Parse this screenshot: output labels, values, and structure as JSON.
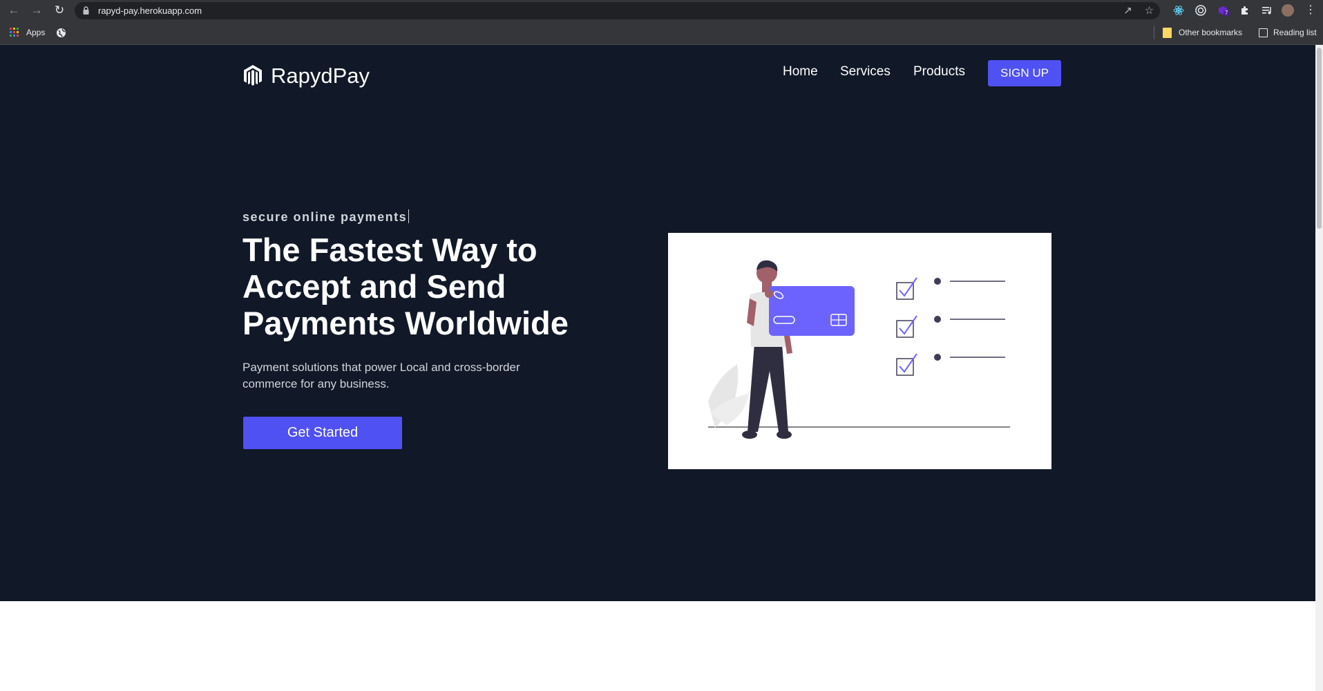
{
  "browser": {
    "url": "rapyd-pay.herokuapp.com",
    "bookmarks": {
      "apps_label": "Apps",
      "other_bookmarks_label": "Other bookmarks",
      "reading_list_label": "Reading list"
    },
    "extension_badge": "7",
    "icons": [
      "back-icon",
      "forward-icon",
      "reload-icon",
      "lock-icon",
      "share-icon",
      "star-icon",
      "react-devtools-icon",
      "target-icon",
      "extension-badge-icon",
      "puzzle-icon",
      "media-icon",
      "profile-avatar",
      "more-menu-icon"
    ]
  },
  "header": {
    "brand": "RapydPay",
    "nav": [
      "Home",
      "Services",
      "Products"
    ],
    "signup_label": "SIGN UP"
  },
  "hero": {
    "kicker": "secure online payments",
    "headline_lines": [
      "The Fastest Way to",
      "Accept and Send",
      "Payments Worldwide"
    ],
    "subtext_lines": [
      "Payment solutions that power Local and cross-border",
      "commerce for any business."
    ],
    "cta_label": "Get Started"
  },
  "colors": {
    "hero_bg": "#111827",
    "accent": "#4f51f2",
    "chrome_bar": "#35363a"
  }
}
